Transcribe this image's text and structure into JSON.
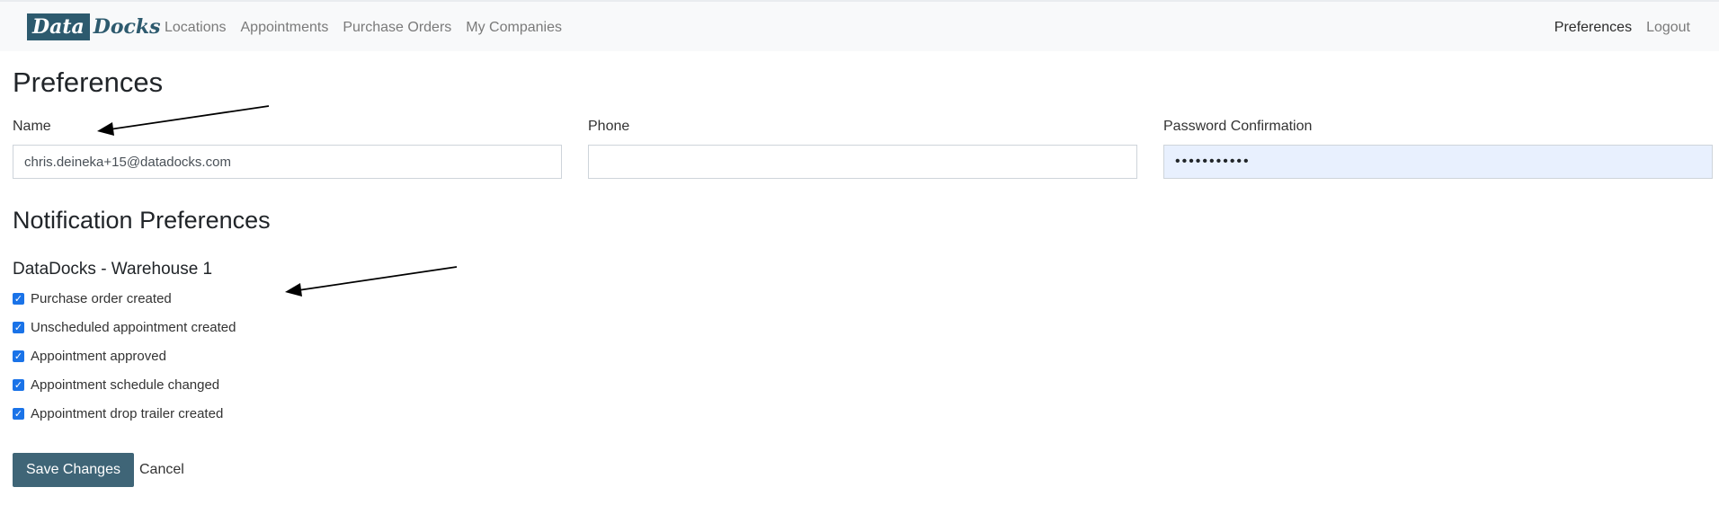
{
  "navbar": {
    "brand_part1": "Data",
    "brand_part2": "Docks",
    "links": [
      "Locations",
      "Appointments",
      "Purchase Orders",
      "My Companies"
    ],
    "right_links": [
      "Preferences",
      "Logout"
    ]
  },
  "preferences": {
    "title": "Preferences",
    "name_label": "Name",
    "name_value": "chris.deineka+15@datadocks.com",
    "phone_label": "Phone",
    "phone_value": "",
    "password_confirmation_label": "Password Confirmation",
    "password_confirmation_value": "•••••••••••"
  },
  "notifications": {
    "title": "Notification Preferences",
    "location": "DataDocks - Warehouse 1",
    "items": [
      {
        "label": "Purchase order created",
        "checked": true
      },
      {
        "label": "Unscheduled appointment created",
        "checked": true
      },
      {
        "label": "Appointment approved",
        "checked": true
      },
      {
        "label": "Appointment schedule changed",
        "checked": true
      },
      {
        "label": "Appointment drop trailer created",
        "checked": true
      }
    ]
  },
  "actions": {
    "save_label": "Save Changes",
    "cancel_label": "Cancel"
  },
  "colors": {
    "brand": "#2d5a6e",
    "save_button": "#3f6577",
    "checkbox": "#1a73e8",
    "autofill_background": "#e8f0fe"
  }
}
